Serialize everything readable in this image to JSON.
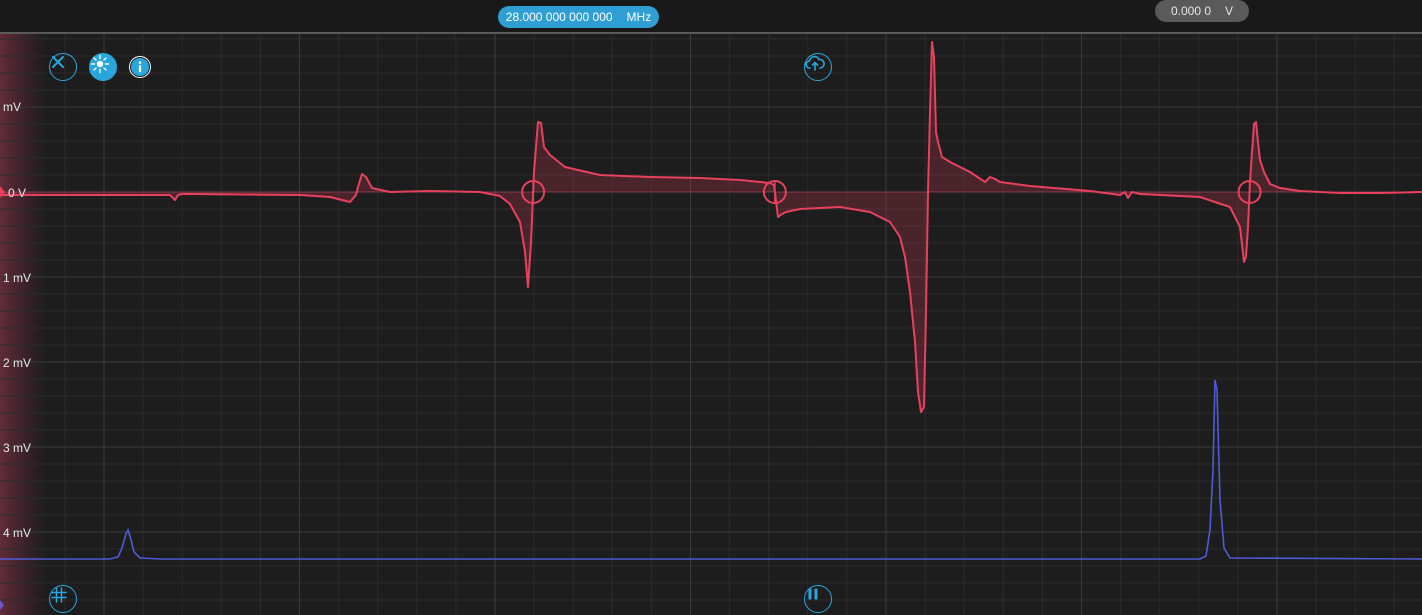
{
  "toolbar": {
    "frequency": {
      "value": "28.000 000 000 000",
      "unit": "MHz"
    },
    "voltage": {
      "value": "0.000 0",
      "unit": "V"
    }
  },
  "icons": {
    "close": "close-icon",
    "brightness": "brightness-icon",
    "info": "info-icon",
    "upload": "cloud-upload-icon",
    "grid": "grid-icon",
    "pause": "pause-icon"
  },
  "colors": {
    "background": "#1d1d1d",
    "trace_primary": "#e8415e",
    "trace_secondary": "#4f5ad8",
    "accent": "#2f9fd3"
  },
  "axis": {
    "labels": [
      "mV",
      "0 V",
      "1 mV",
      "2 mV",
      "3 mV",
      "4 mV"
    ]
  },
  "chart_data": {
    "type": "line",
    "series": [
      {
        "color": "#e8415e",
        "x": [
          0,
          170,
          175,
          178,
          182,
          190,
          300,
          330,
          342,
          350,
          356,
          358,
          362,
          366,
          372,
          390,
          430,
          480,
          500,
          510,
          520,
          525,
          528,
          531,
          534,
          538,
          541,
          544,
          550,
          565,
          600,
          650,
          700,
          740,
          770,
          774,
          778,
          782,
          786,
          800,
          840,
          870,
          890,
          900,
          905,
          910,
          915,
          918,
          921,
          924,
          926,
          928,
          930,
          932,
          934,
          936,
          938,
          942,
          950,
          970,
          985,
          990,
          995,
          1000,
          1030,
          1090,
          1120,
          1125,
          1128,
          1132,
          1140,
          1200,
          1230,
          1240,
          1244,
          1246,
          1248,
          1250,
          1252,
          1254,
          1256,
          1258,
          1260,
          1264,
          1270,
          1280,
          1300,
          1340,
          1380,
          1422
        ],
        "y": [
          -3,
          -3,
          -8,
          -3,
          -2,
          -2,
          -3,
          -5,
          -8,
          -10,
          -3,
          5,
          18,
          15,
          4,
          0,
          1,
          0,
          -4,
          -12,
          -30,
          -60,
          -95,
          -50,
          20,
          70,
          69,
          45,
          37,
          25,
          17,
          15,
          14,
          12,
          9,
          7,
          -25,
          -22,
          -20,
          -17,
          -15,
          -20,
          -30,
          -45,
          -65,
          -100,
          -150,
          -200,
          -220,
          -215,
          -120,
          0,
          80,
          150,
          135,
          60,
          50,
          35,
          30,
          20,
          10,
          15,
          13,
          10,
          6,
          1,
          -3,
          0,
          -6,
          0,
          -2,
          -5,
          -15,
          -35,
          -70,
          -65,
          -35,
          10,
          40,
          68,
          70,
          50,
          32,
          20,
          8,
          4,
          1,
          -1,
          -1,
          0
        ],
        "baseline": 0
      },
      {
        "color": "#4f5ad8",
        "x": [
          0,
          110,
          118,
          122,
          126,
          128,
          130,
          134,
          140,
          160,
          1200,
          1206,
          1210,
          1213,
          1215,
          1217,
          1220,
          1224,
          1230,
          1422
        ],
        "y": [
          1,
          1,
          3,
          12,
          26,
          30,
          24,
          8,
          2,
          1,
          1,
          4,
          30,
          90,
          180,
          170,
          60,
          12,
          2,
          1
        ]
      }
    ]
  }
}
